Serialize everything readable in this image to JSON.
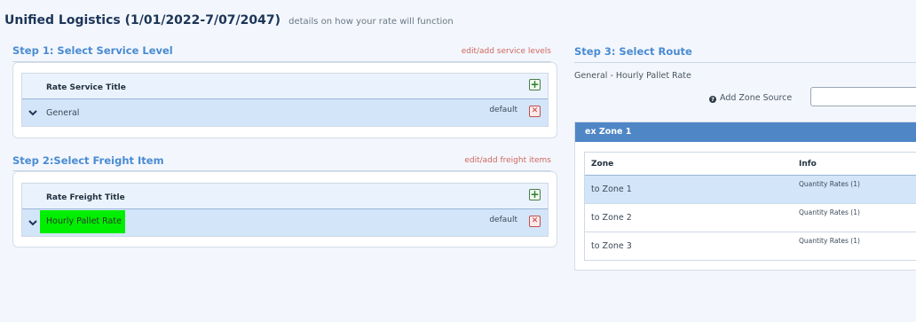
{
  "header": {
    "title": "Unified Logistics (1/01/2022-7/07/2047)",
    "subtitle": "details on how your rate will function"
  },
  "step1": {
    "title": "Step 1: Select Service Level",
    "edit_link": "edit/add service levels",
    "column_header": "Rate Service Title",
    "rows": [
      {
        "label": "General",
        "status": "default"
      }
    ]
  },
  "step2": {
    "title": "Step 2:Select Freight Item",
    "edit_link": "edit/add freight items",
    "column_header": "Rate Freight Title",
    "rows": [
      {
        "label": "Hourly Pallet Rate",
        "status": "default",
        "highlight_color": "#00ee00"
      }
    ]
  },
  "step3": {
    "title": "Step 3: Select Route",
    "route_name": "General - Hourly Pallet Rate",
    "zone_source_label": "Add Zone Source",
    "zone_source_value": "",
    "zone_panel": {
      "title": "ex Zone 1",
      "columns": [
        "Zone",
        "Info"
      ],
      "rows": [
        {
          "zone": "to Zone 1",
          "info": "Quantity Rates (1)",
          "selected": true
        },
        {
          "zone": "to Zone 2",
          "info": "Quantity Rates (1)",
          "selected": false
        },
        {
          "zone": "to Zone 3",
          "info": "Quantity Rates (1)",
          "selected": false
        }
      ]
    }
  },
  "icons": {
    "add": "add-plus-icon",
    "delete": "delete-x-icon",
    "expand": "chevron-down-icon",
    "help": "question-circle-icon"
  },
  "colors": {
    "accent": "#4a8bd1",
    "link": "#d0665e",
    "zone_header": "#4f86c6",
    "selected_row": "#d3e5f9"
  }
}
